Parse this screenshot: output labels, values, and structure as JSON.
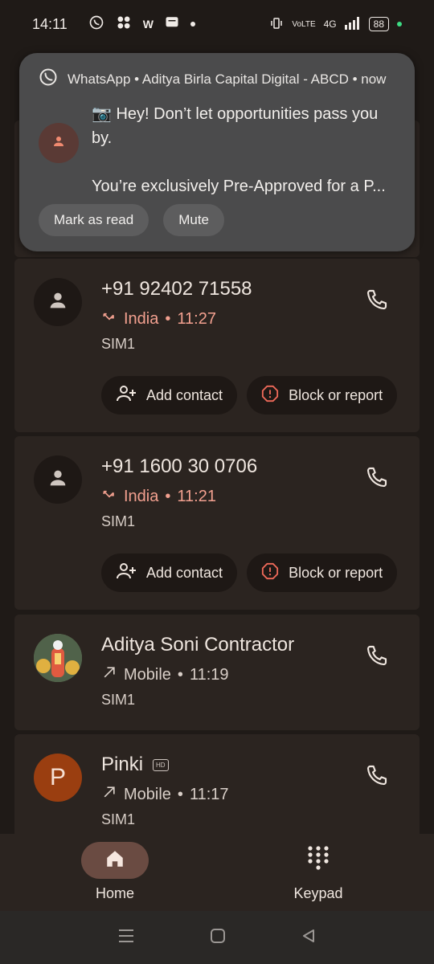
{
  "status_bar": {
    "time": "14:11",
    "battery": "88",
    "network": "4G",
    "volte": "VoLTE"
  },
  "notification": {
    "app": "WhatsApp",
    "source": "WhatsApp • Aditya Birla Capital Digital - ABCD • now",
    "line1": "📷 Hey! Don’t let opportunities pass you by.",
    "line2": "You’re exclusively Pre-Approved for a P...",
    "actions": [
      "Mark as read",
      "Mute"
    ]
  },
  "calls": [
    {
      "name": "+91 92402 71558",
      "type": "missed",
      "location": "India",
      "time": "11:27",
      "sim": "SIM1",
      "add_label": "Add contact",
      "block_label": "Block or report"
    },
    {
      "name": "+91 1600 30 0706",
      "type": "missed",
      "location": "India",
      "time": "11:21",
      "sim": "SIM1",
      "add_label": "Add contact",
      "block_label": "Block or report"
    },
    {
      "name": "Aditya Soni Contractor",
      "type": "outgoing",
      "location": "Mobile",
      "time": "11:19",
      "sim": "SIM1"
    },
    {
      "name": "Pinki",
      "initial": "P",
      "badge": "HD",
      "type": "outgoing",
      "location": "Mobile",
      "time": "11:17",
      "sim": "SIM1"
    }
  ],
  "bottom_nav": {
    "home": "Home",
    "keypad": "Keypad"
  },
  "colors": {
    "accent_missed": "#f2a08f",
    "card": "#2b2420",
    "nav_active": "#6a4b42",
    "avatar_p": "#9a3e10"
  }
}
